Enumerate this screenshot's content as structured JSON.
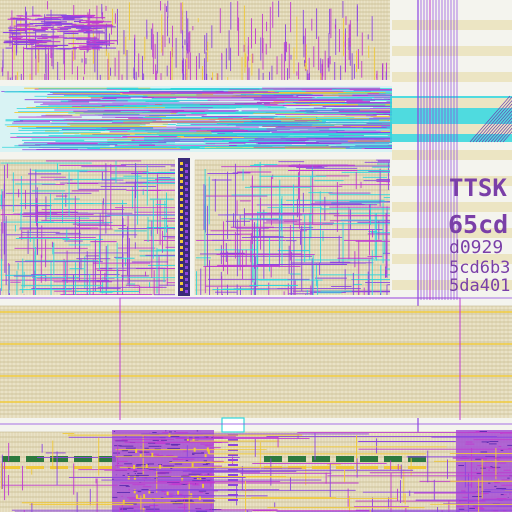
{
  "chip": {
    "logo_text": "TTSK",
    "hash_lines": [
      "65cd",
      "d0929",
      "5cd6b3",
      "5da401"
    ]
  },
  "colors": {
    "background": "#f4f4ee",
    "cell_row": "#e9e2c6",
    "cell_grid": "#b8a778",
    "metal_purple": "#8c45e0",
    "metal_magenta": "#c03bd0",
    "metal_cyan": "#31d6dc",
    "metal_yellow": "#f0c93a",
    "well_green": "#2c7a3e",
    "text_purple": "#7a3fa8"
  }
}
